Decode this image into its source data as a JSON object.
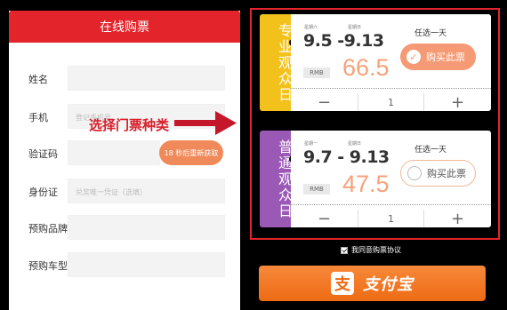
{
  "form": {
    "title": "在线购票",
    "fields": [
      {
        "label": "姓名",
        "placeholder": ""
      },
      {
        "label": "手机",
        "placeholder": "登记手机号"
      },
      {
        "label": "验证码",
        "placeholder": ""
      },
      {
        "label": "身份证",
        "placeholder": "兑奖唯一凭证（选填）"
      },
      {
        "label": "预购品牌",
        "placeholder": ""
      },
      {
        "label": "预购车型",
        "placeholder": ""
      }
    ],
    "sms_button": "18 秒后重新获取"
  },
  "hint": {
    "text": "选择门票种类",
    "arrow_color": "#c4182a"
  },
  "tickets": [
    {
      "type_label": "专业观众日",
      "stub_color": "#f3c11b",
      "day_start": "星期六",
      "day_end": "星期日",
      "date": "9.5 -9.13",
      "currency": "RMB",
      "price": "66.5",
      "any_day": "任选一天",
      "buy_label": "购买此票",
      "selected": true,
      "qty_minus": "−",
      "qty": "1",
      "qty_plus": "+"
    },
    {
      "type_label": "普通观众日",
      "stub_color": "#9b59b6",
      "day_start": "星期一",
      "day_end": "星期日",
      "date": "9.7 - 9.13",
      "currency": "RMB",
      "price": "47.5",
      "any_day": "任选一天",
      "buy_label": "购买此票",
      "selected": false,
      "qty_minus": "−",
      "qty": "1",
      "qty_plus": "+"
    }
  ],
  "agreement": {
    "label": "我同意购票协议",
    "checked": true
  },
  "pay": {
    "label": "支付宝",
    "logo_glyph": "支",
    "color": "#ee6b15"
  }
}
